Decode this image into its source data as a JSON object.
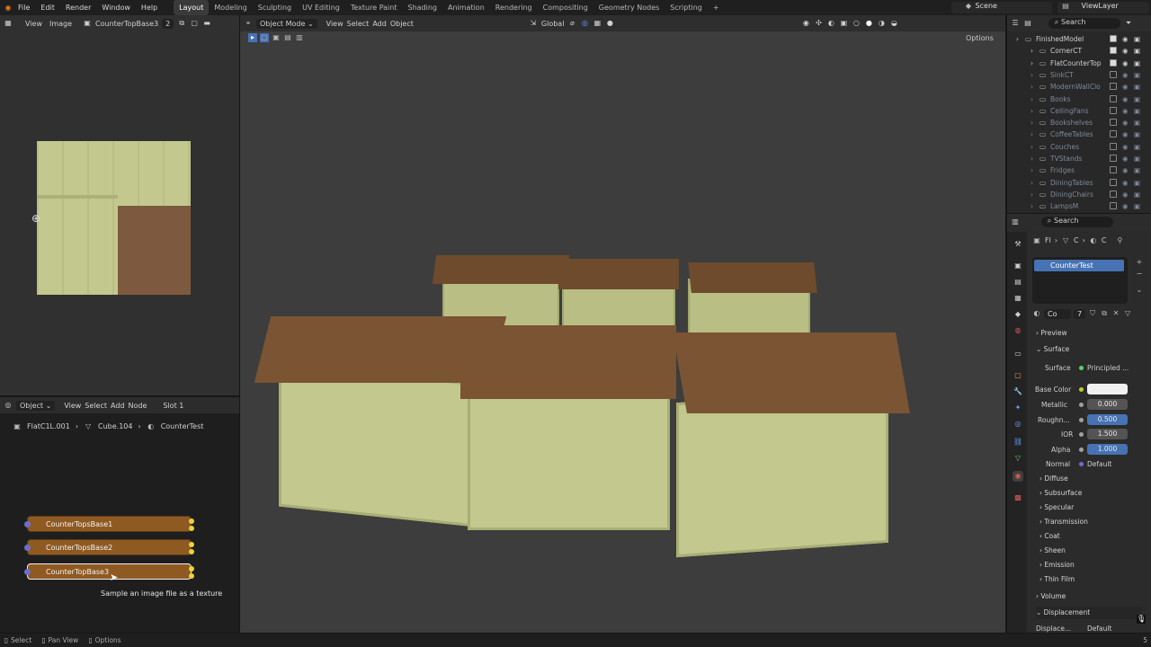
{
  "menu": [
    "File",
    "Edit",
    "Render",
    "Window",
    "Help"
  ],
  "workspaces": [
    "Layout",
    "Modeling",
    "Sculpting",
    "UV Editing",
    "Texture Paint",
    "Shading",
    "Animation",
    "Rendering",
    "Compositing",
    "Geometry Nodes",
    "Scripting"
  ],
  "active_workspace": "Layout",
  "plus": "+",
  "scene": {
    "label": "Scene",
    "view_layer": "ViewLayer"
  },
  "image_editor": {
    "view": "View",
    "image": "Image",
    "image_name": "CounterTopBase3",
    "users": "2"
  },
  "viewport": {
    "mode": "Object Mode",
    "view": "View",
    "select": "Select",
    "add": "Add",
    "object": "Object",
    "orientation": "Global",
    "options": "Options"
  },
  "outliner": {
    "search_placeholder": "Search",
    "rows": [
      {
        "name": "FinishedModel",
        "dim": false,
        "checked": true
      },
      {
        "name": "CornerCT",
        "dim": false,
        "checked": true
      },
      {
        "name": "FlatCounterTop",
        "dim": false,
        "checked": true
      },
      {
        "name": "SinkCT",
        "dim": true,
        "checked": false
      },
      {
        "name": "ModernWallClo",
        "dim": true,
        "checked": false
      },
      {
        "name": "Books",
        "dim": true,
        "checked": false
      },
      {
        "name": "CeilingFans",
        "dim": true,
        "checked": false
      },
      {
        "name": "Bookshelves",
        "dim": true,
        "checked": false
      },
      {
        "name": "CoffeeTables",
        "dim": true,
        "checked": false
      },
      {
        "name": "Couches",
        "dim": true,
        "checked": false
      },
      {
        "name": "TVStands",
        "dim": true,
        "checked": false
      },
      {
        "name": "Fridges",
        "dim": true,
        "checked": false
      },
      {
        "name": "DiningTables",
        "dim": true,
        "checked": false
      },
      {
        "name": "DiningChairs",
        "dim": true,
        "checked": false
      },
      {
        "name": "LampsM",
        "dim": true,
        "checked": false
      }
    ]
  },
  "node_editor": {
    "object": "Object",
    "view": "View",
    "select": "Select",
    "add": "Add",
    "node": "Node",
    "slot": "Slot 1",
    "breadcrumb": [
      "FlatC1L.001",
      "Cube.104",
      "CounterTest"
    ],
    "nodes": [
      "CounterTopsBase1",
      "CounterTopsBase2",
      "CounterTopBase3"
    ],
    "tooltip": "Sample an image file as a texture"
  },
  "properties": {
    "search_placeholder": "Search",
    "crumbs": [
      "Fl",
      "C",
      "C"
    ],
    "material_slot": "CounterTest",
    "material_short": "Co",
    "material_users": "7",
    "sections": {
      "preview": "Preview",
      "surface": "Surface"
    },
    "surface_label": "Surface",
    "surface_value": "Principled ...",
    "fields": [
      {
        "label": "Base Color",
        "value": ""
      },
      {
        "label": "Metallic",
        "value": "0.000"
      },
      {
        "label": "Roughn...",
        "value": "0.500"
      },
      {
        "label": "IOR",
        "value": "1.500"
      },
      {
        "label": "Alpha",
        "value": "1.000"
      },
      {
        "label": "Normal",
        "value": "Default"
      }
    ],
    "subsections": [
      "Diffuse",
      "Subsurface",
      "Specular",
      "Transmission",
      "Coat",
      "Sheen",
      "Emission",
      "Thin Film"
    ],
    "volume": "Volume",
    "displacement": "Displacement",
    "displace_label": "Displace...",
    "displace_value": "Default"
  },
  "status": {
    "select": "Select",
    "pan": "Pan View",
    "options": "Options",
    "version": "5"
  }
}
